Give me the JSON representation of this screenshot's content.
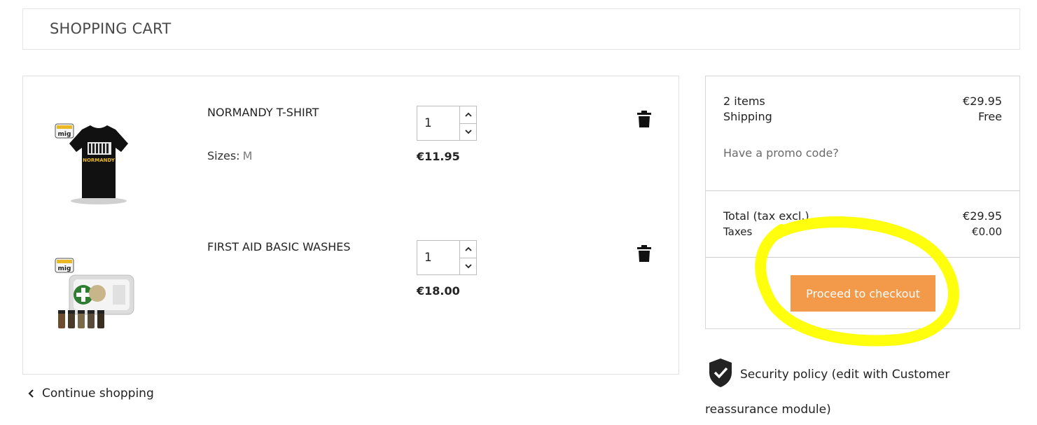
{
  "header": {
    "title": "SHOPPING CART"
  },
  "cart": {
    "items": [
      {
        "name": "NORMANDY T-SHIRT",
        "attr_label": "Sizes:",
        "attr_value": "M",
        "quantity": "1",
        "price": "€11.95",
        "logo_text": "mig",
        "shirt_print": "NORMANDY"
      },
      {
        "name": "FIRST AID BASIC WASHES",
        "quantity": "1",
        "price": "€18.00",
        "logo_text": "mig"
      }
    ],
    "continue_label": "Continue shopping"
  },
  "summary": {
    "items_label": "2 items",
    "items_value": "€29.95",
    "shipping_label": "Shipping",
    "shipping_value": "Free",
    "promo_label": "Have a promo code?",
    "total_label": "Total (tax excl.)",
    "total_value": "€29.95",
    "taxes_label": "Taxes",
    "taxes_value": "€0.00",
    "checkout_label": "Proceed to checkout"
  },
  "reassurance": {
    "text": "Security policy (edit with Customer reassurance module)"
  },
  "colors": {
    "accent": "#f2994a",
    "highlight": "#ffff00"
  },
  "icons": [
    "trash-icon",
    "chevron-up-icon",
    "chevron-down-icon",
    "chevron-left-icon",
    "shield-check-icon"
  ]
}
